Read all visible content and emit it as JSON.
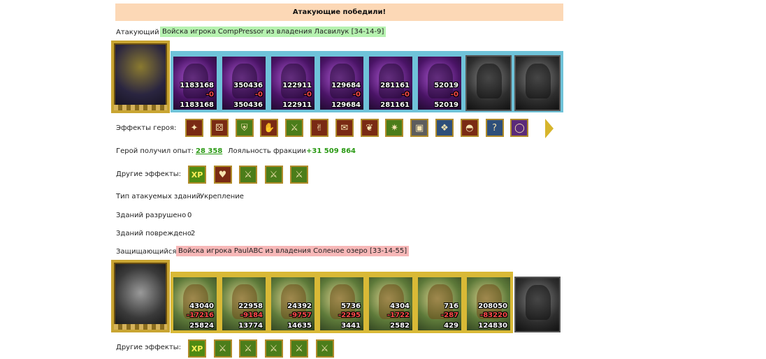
{
  "banner": "Атакующие победили!",
  "attacker": {
    "label": "Атакующий",
    "name": "Войска игрока CompPressor из владения Ласвилук [34-14-9]",
    "units": [
      {
        "top": "1183168",
        "mid": "-0",
        "bot": "1183168"
      },
      {
        "top": "350436",
        "mid": "-0",
        "bot": "350436"
      },
      {
        "top": "122911",
        "mid": "-0",
        "bot": "122911"
      },
      {
        "top": "129684",
        "mid": "-0",
        "bot": "129684"
      },
      {
        "top": "281161",
        "mid": "-0",
        "bot": "281161"
      },
      {
        "top": "52019",
        "mid": "-0",
        "bot": "52019"
      },
      {
        "top": "",
        "mid": "",
        "bot": ""
      },
      {
        "top": "",
        "mid": "",
        "bot": ""
      }
    ],
    "hero_effects_label": "Эффекты героя:",
    "hero_effect_icons": [
      "bag-icon",
      "dice-icon",
      "shield-icon",
      "hand-icon",
      "sword-icon",
      "handshake-icon",
      "scroll-icon",
      "pouch-icon",
      "claw-icon",
      "armor-icon",
      "crystal-icon",
      "helmet-icon",
      "question-icon",
      "ring-icon"
    ],
    "xp_label": "Герой получил опыт:",
    "xp_value": "28 358",
    "loyalty_label": "Лояльность фракции",
    "loyalty_value": "+31 509 864",
    "other_effects_label": "Другие эффекты:",
    "other_effect_icons": [
      "xp-icon",
      "heart-icon",
      "sword-icon",
      "sword-icon",
      "sword-icon"
    ],
    "xp_icon_text": "XP",
    "buildings_type_label": "Тип атакуемых зданий",
    "buildings_type_value": "Укрепление",
    "destroyed_label": "Зданий разрушено",
    "destroyed_value": "0",
    "damaged_label": "Зданий повреждено",
    "damaged_value": "2"
  },
  "defender": {
    "label": "Защищающийся",
    "name": "Войска игрока PaulABC из владения Соленое озеро [33-14-55]",
    "units": [
      {
        "top": "43040",
        "mid": "-17216",
        "bot": "25824"
      },
      {
        "top": "22958",
        "mid": "-9184",
        "bot": "13774"
      },
      {
        "top": "24392",
        "mid": "-9757",
        "bot": "14635"
      },
      {
        "top": "5736",
        "mid": "-2295",
        "bot": "3441"
      },
      {
        "top": "4304",
        "mid": "-1722",
        "bot": "2582"
      },
      {
        "top": "716",
        "mid": "-287",
        "bot": "429"
      },
      {
        "top": "208050",
        "mid": "-83220",
        "bot": "124830"
      }
    ],
    "other_effects_label": "Другие эффекты:",
    "other_effect_icons": [
      "xp-icon",
      "sword-icon",
      "sword-icon",
      "sword-icon",
      "sword-icon",
      "sword-icon"
    ],
    "xp_icon_text": "XP"
  }
}
